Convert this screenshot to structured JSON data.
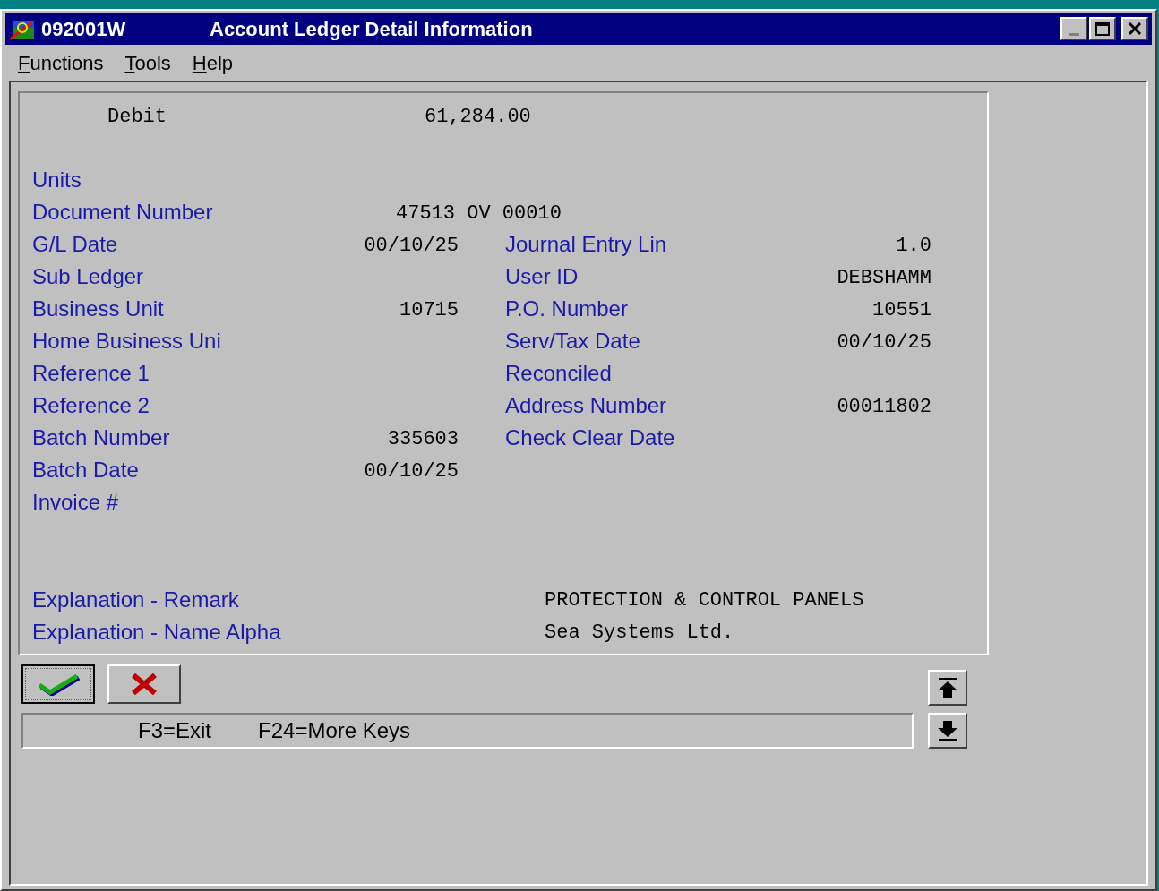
{
  "window": {
    "code": "092001W",
    "title": "Account Ledger Detail Information"
  },
  "menu": [
    {
      "label": "Functions"
    },
    {
      "label": "Tools"
    },
    {
      "label": "Help"
    }
  ],
  "debit": {
    "label": "Debit",
    "value": "61,284.00"
  },
  "rows": [
    {
      "kind": "pair",
      "label": "Units"
    },
    {
      "kind": "wide",
      "label": "Document Number",
      "value": "47513 OV 00010"
    },
    {
      "kind": "pair",
      "label": "G/L Date",
      "value": "00/10/25",
      "right_label": "Journal Entry Lin",
      "right_value": "1.0"
    },
    {
      "kind": "pair",
      "label": "Sub Ledger",
      "right_label": "User ID",
      "right_value": "DEBSHAMM"
    },
    {
      "kind": "pair",
      "label": "Business Unit",
      "value": "10715",
      "right_label": "P.O. Number",
      "right_value": "10551"
    },
    {
      "kind": "pair",
      "label": "Home Business Uni",
      "right_label": "Serv/Tax Date",
      "right_value": "00/10/25"
    },
    {
      "kind": "pair",
      "label": "Reference 1",
      "right_label": "Reconciled"
    },
    {
      "kind": "pair",
      "label": "Reference 2",
      "right_label": "Address Number",
      "right_value": "00011802"
    },
    {
      "kind": "pair",
      "label": "Batch Number",
      "value": "335603",
      "right_label": "Check Clear Date"
    },
    {
      "kind": "pair",
      "label": "Batch Date",
      "value": "00/10/25"
    },
    {
      "kind": "pair",
      "label": "Invoice #"
    }
  ],
  "explanations": [
    {
      "label": "Explanation - Remark",
      "value": "PROTECTION & CONTROL PANELS"
    },
    {
      "label": "Explanation - Name Alpha",
      "value": "Sea Systems Ltd."
    }
  ],
  "keys": [
    "F3=Exit",
    "F24=More Keys"
  ]
}
